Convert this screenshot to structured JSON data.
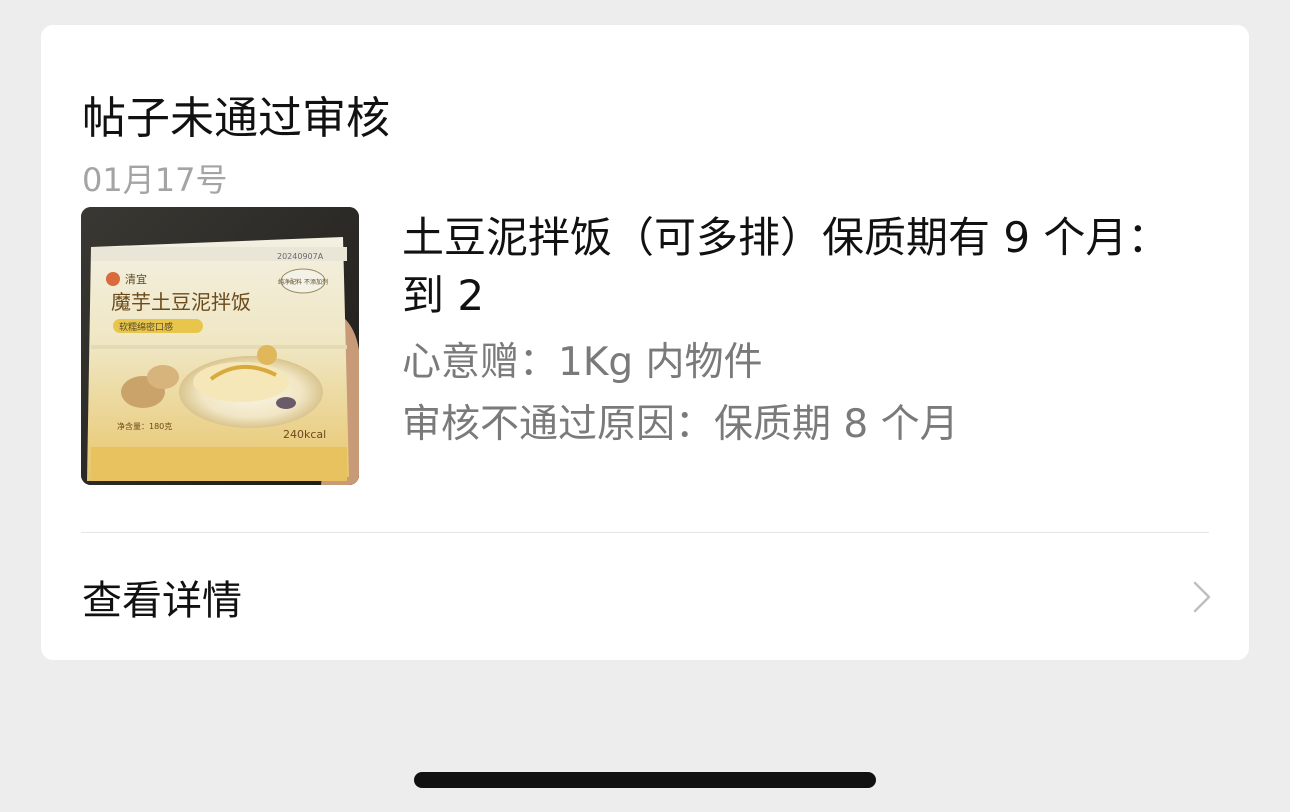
{
  "notification": {
    "title": "帖子未通过审核",
    "date": "01月17号",
    "post": {
      "title": "土豆泥拌饭（可多排）保质期有 9 个月：到 2",
      "gift": "心意赠：1Kg 内物件",
      "reason": "审核不通过原因：保质期 8 个月",
      "image": {
        "brand": "清宜",
        "product_name": "魔芋土豆泥拌饭",
        "subtitle": "软糯绵密口感",
        "code": "20240907A",
        "badge": "纯净配料 不添加剂",
        "calories": "240kcal",
        "net_weight": "净含量：180克"
      }
    },
    "detail_label": "查看详情"
  },
  "icons": {
    "chevron": "chevron-right-icon"
  },
  "colors": {
    "background": "#ededed",
    "card": "#ffffff",
    "text_primary": "#111111",
    "text_secondary": "#7a7a7a",
    "date": "#a4a4a4"
  }
}
